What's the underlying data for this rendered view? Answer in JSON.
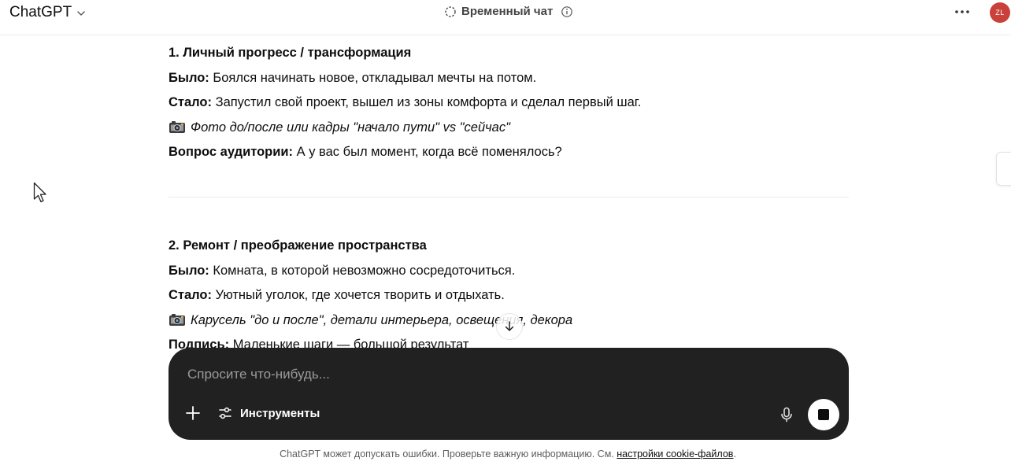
{
  "header": {
    "brand": "ChatGPT",
    "chat_title": "Временный чат",
    "avatar_initials": "ZL"
  },
  "sections": [
    {
      "heading": "1. Личный прогресс / трансформация",
      "before_label": "Было:",
      "before_text": " Боялся начинать новое, откладывал мечты на потом.",
      "after_label": "Стало:",
      "after_text": " Запустил свой проект, вышел из зоны комфорта и сделал первый шаг.",
      "photo_text": "Фото до/после или кадры \"начало пути\" vs \"сейчас\"",
      "extra_label": "Вопрос аудитории:",
      "extra_text": " А у вас был момент, когда всё поменялось?"
    },
    {
      "heading": "2. Ремонт / преображение пространства",
      "before_label": "Было:",
      "before_text": " Комната, в которой невозможно сосредоточиться.",
      "after_label": "Стало:",
      "after_text": " Уютный уголок, где хочется творить и отдыхать.",
      "photo_text": "Карусель \"до и после\", детали интерьера, освещения, декора",
      "extra_label": "Подпись:",
      "extra_text": " Маленькие шаги — большой результат"
    }
  ],
  "composer": {
    "placeholder": "Спросите что-нибудь...",
    "value": "",
    "tools_label": "Инструменты"
  },
  "footer": {
    "text": "ChatGPT может допускать ошибки. Проверьте важную информацию. См. ",
    "link": "настройки cookie-файлов",
    "suffix": "."
  },
  "colors": {
    "composer_bg": "#212121",
    "avatar_bg": "#c9413a",
    "text": "#0d0d0d"
  }
}
